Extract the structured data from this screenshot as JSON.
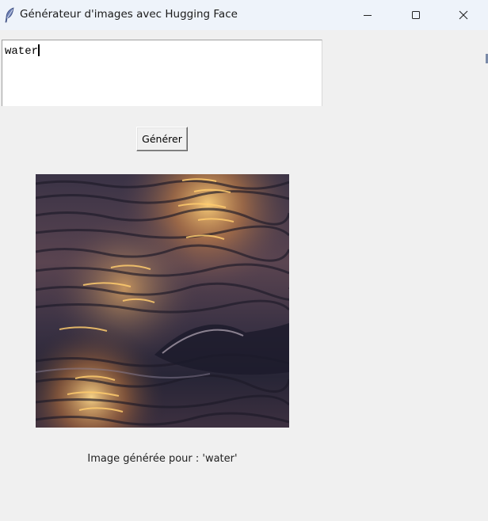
{
  "window": {
    "title": "Générateur d'images avec Hugging Face",
    "icon": "feather-icon",
    "controls": [
      "minimize-icon",
      "maximize-icon",
      "close-icon"
    ]
  },
  "prompt_input": {
    "value": "water"
  },
  "generate_button": {
    "label": "Générer"
  },
  "generated_image": {
    "subject": "water"
  },
  "caption": {
    "text": "Image générée pour : 'water'"
  },
  "colors": {
    "titlebar": "#eef3fa",
    "background": "#f0f0f0",
    "image_water": "#2c2a3d",
    "image_highlight": "#f6c25a"
  }
}
